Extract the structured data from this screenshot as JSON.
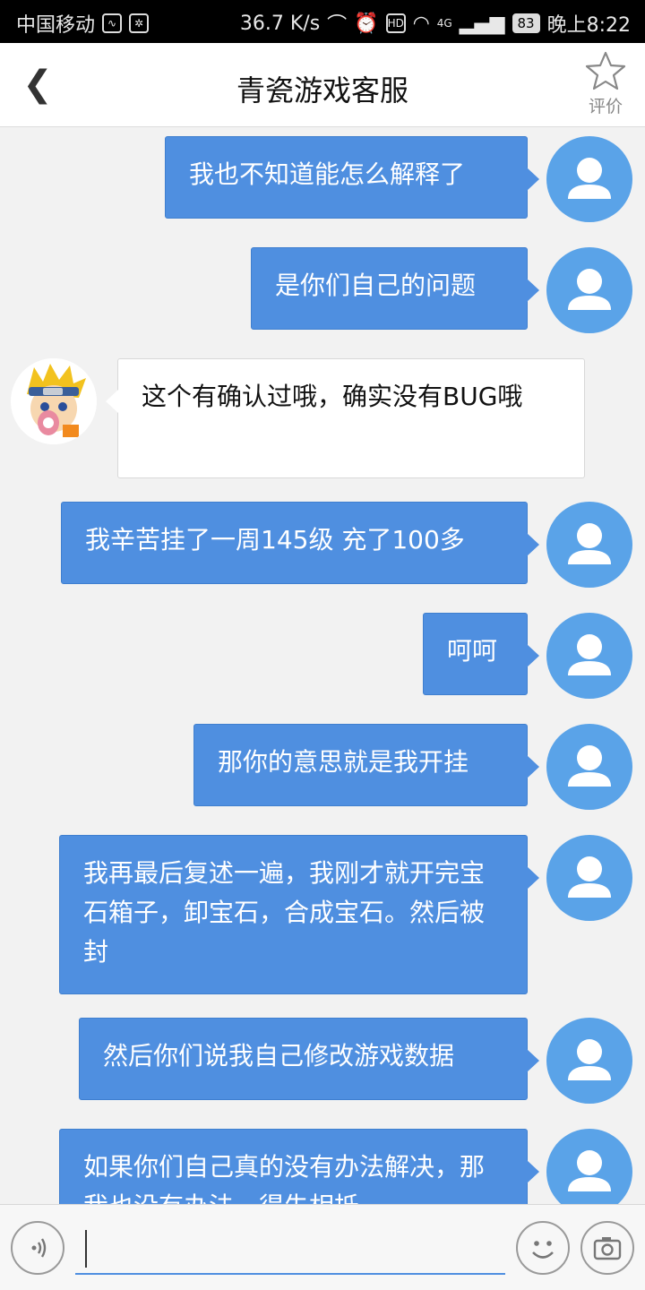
{
  "status_bar": {
    "carrier": "中国移动",
    "speed": "36.7 K/s",
    "network": "4G",
    "battery": "83",
    "time": "晚上8:22"
  },
  "header": {
    "title": "青瓷游戏客服",
    "back_glyph": "❮",
    "rate_label": "评价"
  },
  "messages": [
    {
      "sender": "user",
      "text": "我也不知道能怎么解释了"
    },
    {
      "sender": "user",
      "text": "是你们自己的问题"
    },
    {
      "sender": "support",
      "text": "这个有确认过哦，确实没有BUG哦"
    },
    {
      "sender": "user",
      "text": "我辛苦挂了一周145级 充了100多"
    },
    {
      "sender": "user",
      "text": "呵呵"
    },
    {
      "sender": "user",
      "text": "那你的意思就是我开挂"
    },
    {
      "sender": "user",
      "text": "我再最后复述一遍，我刚才就开完宝石箱子，卸宝石，合成宝石。然后被封"
    },
    {
      "sender": "user",
      "text": "然后你们说我自己修改游戏数据"
    },
    {
      "sender": "user",
      "text": "如果你们自己真的没有办法解决，那我也没有办法，得失相抵"
    }
  ],
  "input_bar": {
    "voice_icon": "voice-icon",
    "emoji_icon": "emoji-icon",
    "camera_icon": "camera-icon",
    "placeholder": ""
  },
  "colors": {
    "user_bubble": "#4f8fe0",
    "user_avatar": "#5aa3e8",
    "support_bubble": "#ffffff",
    "background": "#f2f2f2"
  }
}
